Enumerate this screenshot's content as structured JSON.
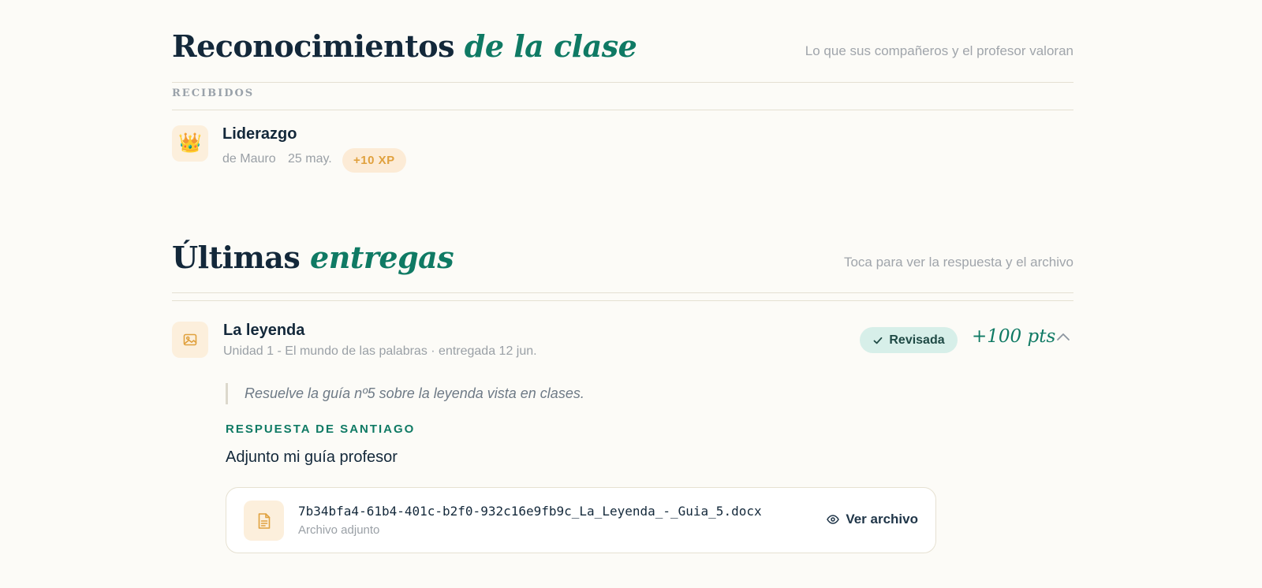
{
  "recognitions": {
    "title_main": "Reconocimientos",
    "title_accent": "de la clase",
    "subtitle": "Lo que sus compañeros y el profesor valoran",
    "kicker": "RECIBIDOS",
    "items": [
      {
        "icon": "crown-icon",
        "emoji": "👑",
        "title": "Liderazgo",
        "from": "de Mauro",
        "date": "25 may.",
        "xp": "+10 XP"
      }
    ]
  },
  "submissions": {
    "title_main": "Últimas",
    "title_accent": "entregas",
    "subtitle": "Toca para ver la respuesta y el archivo",
    "items": [
      {
        "icon": "image-icon",
        "title": "La leyenda",
        "meta": "Unidad 1 - El mundo de las palabras · entregada 12 jun.",
        "status": "Revisada",
        "points": "+100 pts",
        "prompt": "Resuelve la guía nº5 sobre la leyenda vista en clases.",
        "response_label": "RESPUESTA DE SANTIAGO",
        "response_text": "Adjunto mi guía profesor",
        "file": {
          "icon": "document-icon",
          "name": "7b34bfa4-61b4-401c-b2f0-932c16e9fb9c_La_Leyenda_-_Guia_5.docx",
          "sub": "Archivo adjunto",
          "action": "Ver archivo"
        }
      }
    ]
  },
  "colors": {
    "background": "#fcfbf7",
    "accent_green": "#0f7a64",
    "heading": "#13283a",
    "muted": "#9aa0a6",
    "xp_badge_bg": "#fcebd6",
    "xp_badge_text": "#e0a13e",
    "status_bg": "#d7efe9"
  }
}
